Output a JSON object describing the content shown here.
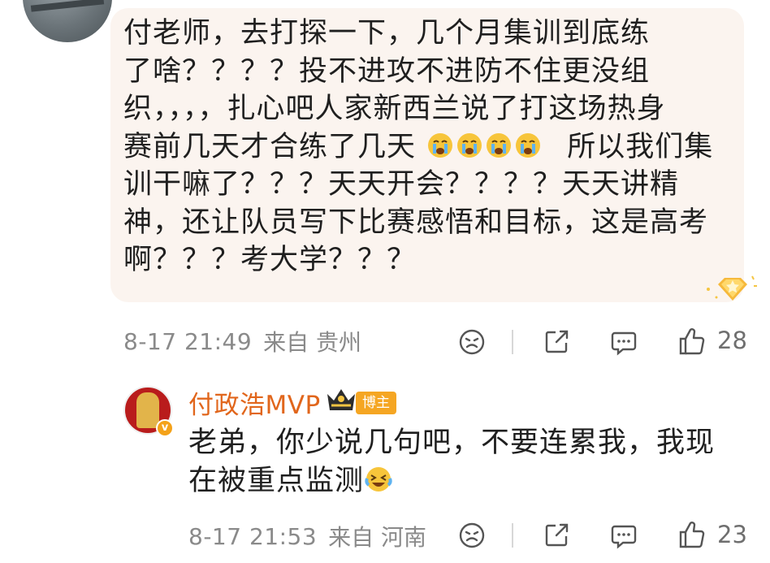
{
  "comment": {
    "text_lines": [
      "付老师，去打探一下，几个月集训到底练",
      "了啥？？？？投不进攻不进防不住更没组",
      "织，，，，扎心吧人家新西兰说了打这场热身",
      "赛前几天才合练了几天",
      "所以我们集",
      "训干嘛了？？？天天开会？？？？天天讲精",
      "神，还让队员写下比赛感悟和目标，这是高考",
      "啊？？？考大学？？？"
    ],
    "time": "8-17 21:49",
    "location": "来自 贵州",
    "like_count": "28"
  },
  "reply": {
    "author": "付政浩MVP",
    "author_tag": "博主",
    "text_line1": "老弟，你少说几句吧，不要连累我，我现",
    "text_line2": "在被重点监测",
    "time": "8-17 21:53",
    "location": "来自 河南",
    "like_count": "23"
  },
  "colors": {
    "author_name": "#e1661c",
    "bubble_bg": "#fbf4ef",
    "meta_text": "#8a8a8a",
    "tag_bg": "#f5a623"
  },
  "icons": [
    "crying-emoji-icon",
    "laughing-tears-emoji-icon",
    "emoji-face-icon",
    "share-icon",
    "comment-icon",
    "like-thumb-icon",
    "crown-icon",
    "star-badge-icon"
  ]
}
